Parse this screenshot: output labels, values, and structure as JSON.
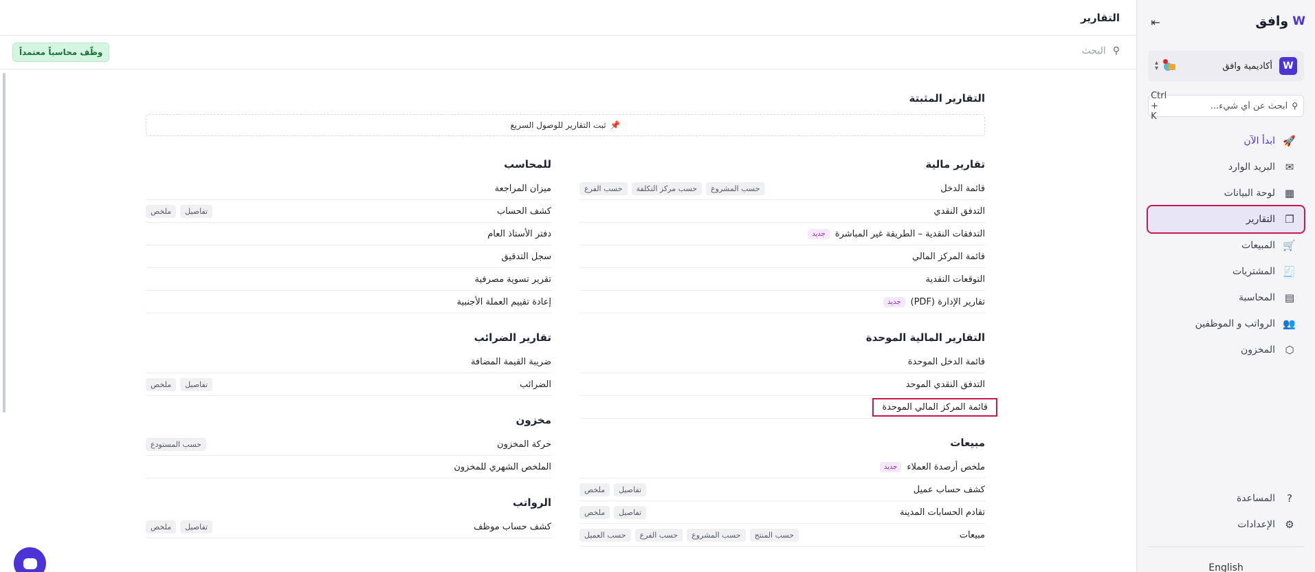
{
  "app": {
    "logo_text": "وافق",
    "logo_mark": "W"
  },
  "org": {
    "name": "أكاديمية وافق",
    "initial": "W"
  },
  "sidebar_search": {
    "placeholder": "ابحث عن أي شيء...",
    "shortcut": "Ctrl + K"
  },
  "nav": [
    {
      "label": "ابدأ الآن",
      "icon": "rocket-icon",
      "glyph": "🚀",
      "accent": true
    },
    {
      "label": "البريد الوارد",
      "icon": "inbox-icon",
      "glyph": "✉"
    },
    {
      "label": "لوحة البيانات",
      "icon": "dashboard-icon",
      "glyph": "▦"
    },
    {
      "label": "التقارير",
      "icon": "reports-icon",
      "glyph": "❐",
      "active": true
    },
    {
      "label": "المبيعات",
      "icon": "cart-icon",
      "glyph": "🛒"
    },
    {
      "label": "المشتريات",
      "icon": "receipt-icon",
      "glyph": "🧾"
    },
    {
      "label": "المحاسبة",
      "icon": "ledger-icon",
      "glyph": "▤"
    },
    {
      "label": "الرواتب و الموظفين",
      "icon": "users-icon",
      "glyph": "👥"
    },
    {
      "label": "المخزون",
      "icon": "box-icon",
      "glyph": "⬡"
    }
  ],
  "nav_bottom": [
    {
      "label": "المساعدة",
      "icon": "help-icon",
      "glyph": "?"
    },
    {
      "label": "الإعدادات",
      "icon": "gear-icon",
      "glyph": "⚙"
    }
  ],
  "language": "English",
  "page": {
    "title": "التقارير",
    "search_placeholder": "البحث",
    "hire_button": "وظّف محاسباً معتمداً"
  },
  "pinned": {
    "title": "التقارير المثبتة",
    "hint": "ثبت التقارير للوصول السريع"
  },
  "new_label": "جديد",
  "right_groups": [
    {
      "title": "تقارير مالية",
      "rows": [
        {
          "label": "قائمة الدخل",
          "tags": [
            "حسب الفرع",
            "حسب مركز التكلفة",
            "حسب المشروع"
          ]
        },
        {
          "label": "التدفق النقدي",
          "tags": []
        },
        {
          "label": "التدفقات النقدية – الطريقة غير المباشرة",
          "tags": [],
          "new": true
        },
        {
          "label": "قائمة المركز المالي",
          "tags": []
        },
        {
          "label": "التوقعات النقدية",
          "tags": []
        },
        {
          "label": "تقارير الإدارة (PDF)",
          "tags": [],
          "new": true
        }
      ]
    },
    {
      "title": "التقارير المالية الموحدة",
      "rows": [
        {
          "label": "قائمة الدخل الموحدة",
          "tags": []
        },
        {
          "label": "التدفق النقدي الموحد",
          "tags": []
        },
        {
          "label": "قائمة المركز المالي الموحدة",
          "tags": [],
          "highlight": true
        }
      ]
    },
    {
      "title": "مبيعات",
      "rows": [
        {
          "label": "ملخص أرصدة العملاء",
          "tags": [],
          "new": true
        },
        {
          "label": "كشف حساب عميل",
          "tags": [
            "ملخص",
            "تفاصيل"
          ]
        },
        {
          "label": "تقادم الحسابات المدينة",
          "tags": [
            "ملخص",
            "تفاصيل"
          ]
        },
        {
          "label": "مبيعات",
          "tags": [
            "حسب العميل",
            "حسب الفرع",
            "حسب المشروع",
            "حسب المنتج"
          ]
        }
      ]
    }
  ],
  "left_groups": [
    {
      "title": "للمحاسب",
      "rows": [
        {
          "label": "ميزان المراجعة",
          "tags": []
        },
        {
          "label": "كشف الحساب",
          "tags": [
            "ملخص",
            "تفاصيل"
          ]
        },
        {
          "label": "دفتر الأستاذ العام",
          "tags": []
        },
        {
          "label": "سجل التدقيق",
          "tags": []
        },
        {
          "label": "تقرير تسوية مصرفية",
          "tags": []
        },
        {
          "label": "إعادة تقييم العملة الأجنبية",
          "tags": []
        }
      ]
    },
    {
      "title": "تقارير الضرائب",
      "rows": [
        {
          "label": "ضريبة القيمة المضافة",
          "tags": []
        },
        {
          "label": "الضرائب",
          "tags": [
            "ملخص",
            "تفاصيل"
          ]
        }
      ]
    },
    {
      "title": "مخزون",
      "rows": [
        {
          "label": "حركة المخزون",
          "tags": [
            "حسب المستودع"
          ]
        },
        {
          "label": "الملخص الشهري للمخزون",
          "tags": []
        }
      ]
    },
    {
      "title": "الرواتب",
      "rows": [
        {
          "label": "كشف حساب موظف",
          "tags": [
            "ملخص",
            "تفاصيل"
          ]
        }
      ]
    }
  ]
}
